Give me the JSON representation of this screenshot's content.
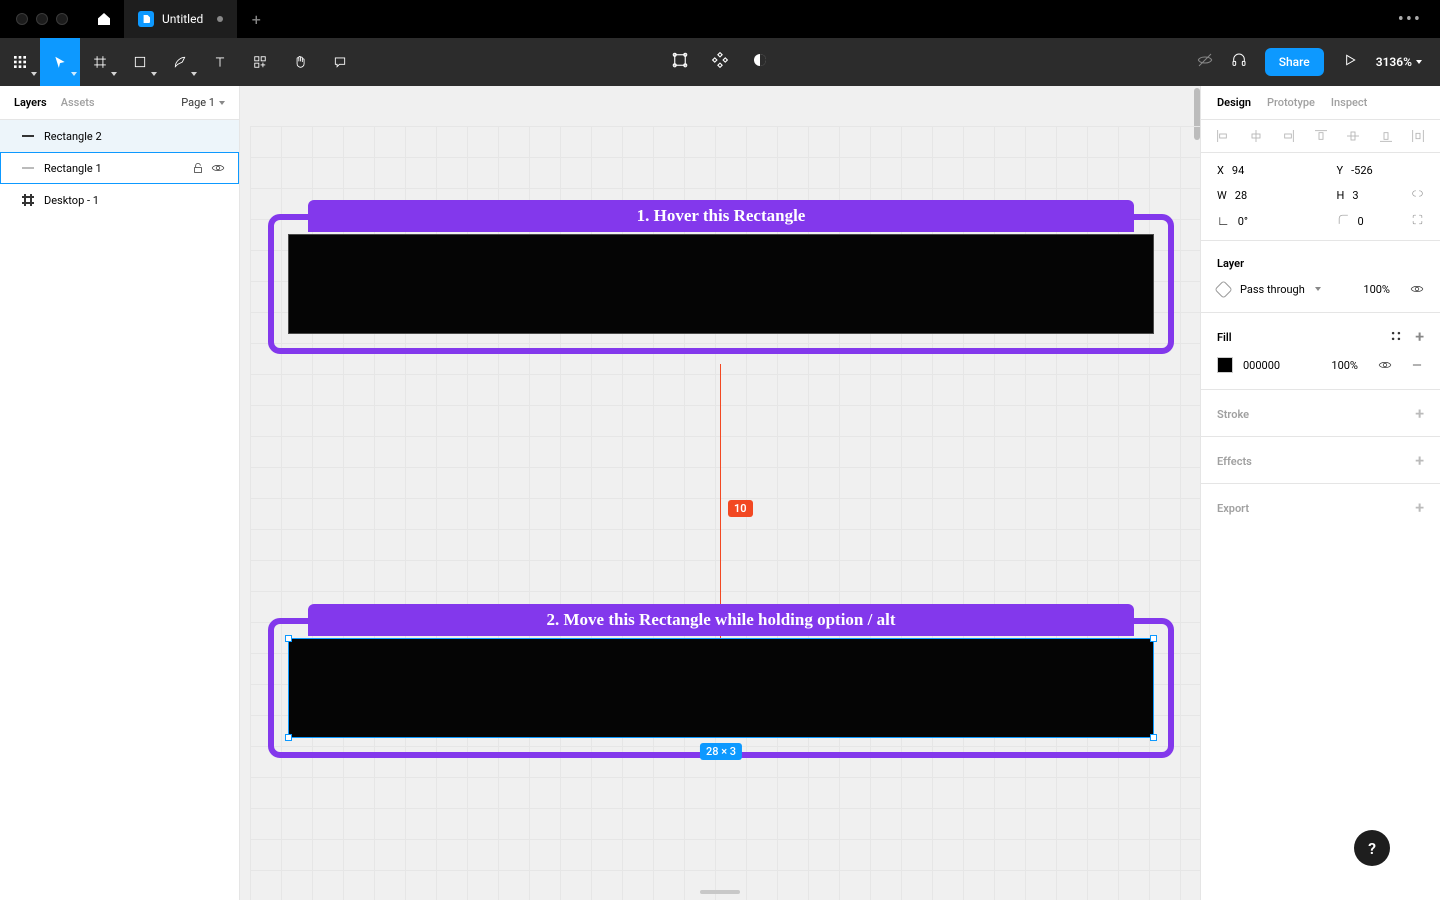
{
  "titlebar": {
    "tab_title": "Untitled"
  },
  "toolbar": {
    "share_label": "Share",
    "zoom": "3136%"
  },
  "left_panel": {
    "tabs": {
      "layers": "Layers",
      "assets": "Assets"
    },
    "page": "Page 1",
    "layers": [
      {
        "name": "Rectangle 2",
        "state": "hover"
      },
      {
        "name": "Rectangle 1",
        "state": "selected"
      },
      {
        "name": "Desktop - 1",
        "state": "normal",
        "type": "frame"
      }
    ]
  },
  "canvas": {
    "frame1_label": "1. Hover this Rectangle",
    "frame2_label": "2. Move this Rectangle while holding option / alt",
    "distance": "10",
    "selection_dims": "28 × 3"
  },
  "right_panel": {
    "tabs": {
      "design": "Design",
      "prototype": "Prototype",
      "inspect": "Inspect"
    },
    "transform": {
      "x_label": "X",
      "x": "94",
      "y_label": "Y",
      "y": "-526",
      "w_label": "W",
      "w": "28",
      "h_label": "H",
      "h": "3",
      "rot_label": "⟀",
      "rot": "0°",
      "corner_label": "⌐",
      "corner": "0"
    },
    "layer_section": {
      "heading": "Layer",
      "blend_mode": "Pass through",
      "opacity": "100%"
    },
    "fill_section": {
      "heading": "Fill",
      "hex": "000000",
      "opacity": "100%"
    },
    "stroke_heading": "Stroke",
    "effects_heading": "Effects",
    "export_heading": "Export"
  },
  "help": "?"
}
